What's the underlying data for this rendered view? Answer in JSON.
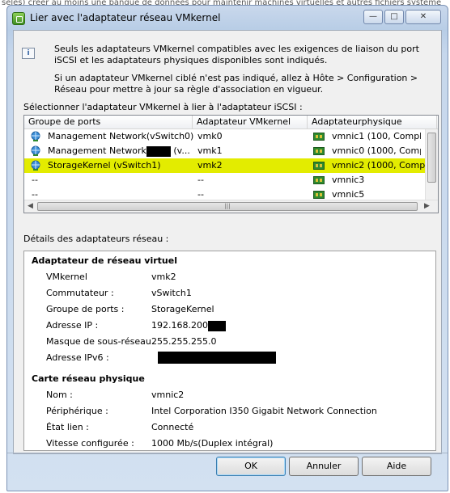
{
  "background_text": "sélés) créer au moins une banque de données pour maintenir machines virtuelles et autres fichiers système",
  "window": {
    "title": "Lier avec l'adaptateur réseau VMkernel",
    "buttons": {
      "minimize": "—",
      "maximize": "□",
      "close": "✕"
    }
  },
  "info": {
    "line1": "Seuls les adaptateurs VMkernel compatibles avec les exigences de liaison du port iSCSI et les adaptateurs physiques disponibles sont indiqués.",
    "line2": "Si un adaptateur VMkernel ciblé n'est pas indiqué, allez à Hôte > Configuration > Réseau pour mettre à jour sa règle d'association en vigueur."
  },
  "select_label": "Sélectionner l'adaptateur VMkernel à lier à l'adaptateur iSCSI :",
  "table": {
    "columns": [
      "Groupe de ports",
      "Adaptateur VMkernel",
      "Adaptateurphysique"
    ],
    "rows": [
      {
        "port_group": "Management Network(vSwitch0)",
        "vmkernel": "vmk0",
        "physical": "vmnic1 (100, Complè",
        "selected": false,
        "port_icon": "network-globe-icon"
      },
      {
        "port_group": "Management Network",
        "port_group_suffix": " (v...",
        "vmkernel": "vmk1",
        "physical": "vmnic0 (1000, Compl",
        "selected": false,
        "port_icon": "network-globe-icon"
      },
      {
        "port_group": "StorageKernel (vSwitch1)",
        "vmkernel": "vmk2",
        "physical": "vmnic2 (1000, Compl",
        "selected": true,
        "port_icon": "network-globe-icon"
      },
      {
        "port_group": "--",
        "vmkernel": "--",
        "physical": "vmnic3",
        "selected": false
      },
      {
        "port_group": "--",
        "vmkernel": "--",
        "physical": "vmnic5",
        "selected": false
      }
    ]
  },
  "details_label": "Détails des adaptateurs réseau :",
  "virtual_adapter": {
    "title": "Adaptateur de réseau virtuel",
    "fields": [
      {
        "label": "VMkernel",
        "value": "vmk2"
      },
      {
        "label": "Commutateur :",
        "value": "vSwitch1"
      },
      {
        "label": "Groupe de ports :",
        "value": "StorageKernel"
      },
      {
        "label": "Adresse IP :",
        "value": "192.168.200"
      },
      {
        "label": "Masque de sous-réseau.",
        "value": "255.255.255.0"
      },
      {
        "label": "Adresse IPv6 :",
        "value": ""
      }
    ]
  },
  "physical_adapter": {
    "title": "Carte réseau physique",
    "fields": [
      {
        "label": "Nom :",
        "value": "vmnic2"
      },
      {
        "label": "Périphérique :",
        "value": "Intel Corporation I350 Gigabit Network Connection"
      },
      {
        "label": "État lien :",
        "value": "Connecté"
      },
      {
        "label": "Vitesse configurée :",
        "value": "1000 Mb/s(Duplex intégral)"
      }
    ]
  },
  "buttons": {
    "ok": "OK",
    "cancel": "Annuler",
    "help": "Aide"
  },
  "colors": {
    "selection": "#e3ec00",
    "title_bar": "#b8cde6"
  }
}
